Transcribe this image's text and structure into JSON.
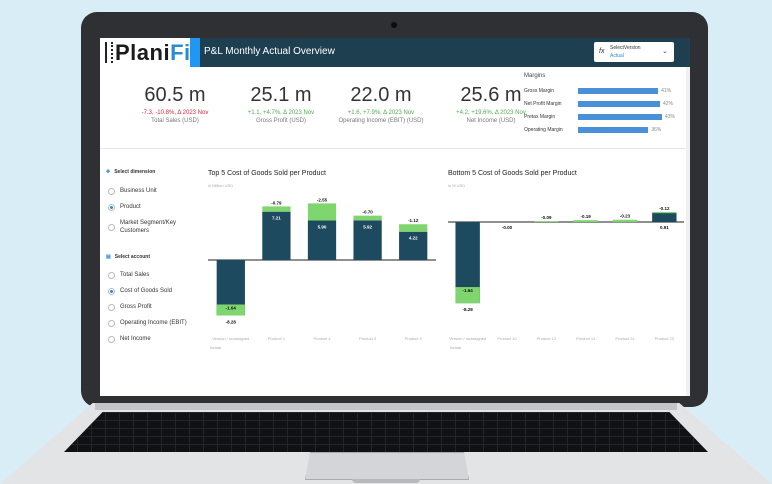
{
  "app": {
    "logo_text_main": "Plani",
    "logo_text_accent": "Fi",
    "title": "P&L Monthly Actual Overview",
    "select_version_label": "SelectVersion",
    "select_version_value": "Actual",
    "fx_symbol": "fx"
  },
  "kpis": [
    {
      "value": "60.5 m",
      "delta": "-7.3, -10.8%, Δ 2023 Nov",
      "name": "Total Sales (USD)",
      "delta_color": "#e0243a"
    },
    {
      "value": "25.1 m",
      "delta": "+1.1, +4.7%, Δ 2023 Nov",
      "name": "Gross Profit (USD)",
      "delta_color": "#4cae4c"
    },
    {
      "value": "22.0 m",
      "delta": "+1.6, +7.9%, Δ 2023 Nov",
      "name": "Operating Income (EBIT) (USD)",
      "delta_color": "#4cae4c"
    },
    {
      "value": "25.6 m",
      "delta": "+4.2, +19.6%, Δ 2023 Nov",
      "name": "Net Income (USD)",
      "delta_color": "#4cae4c"
    }
  ],
  "margins": {
    "title": "Margins",
    "rows": [
      {
        "label": "Gross Margin",
        "pct_label": "41%",
        "value": 0.41
      },
      {
        "label": "Net Profit Margin",
        "pct_label": "42%",
        "value": 0.42
      },
      {
        "label": "Pretax Margin",
        "pct_label": "43%",
        "value": 0.43
      },
      {
        "label": "Operating Margin",
        "pct_label": "36%",
        "value": 0.36
      }
    ]
  },
  "filters": {
    "dimension_title": "Select dimension",
    "dimension_options": [
      "Business Unit",
      "Product",
      "Market Segment/Key Customers"
    ],
    "dimension_selected": 1,
    "account_title": "Select account",
    "account_options": [
      "Total Sales",
      "Cost of Goods Sold",
      "Gross Profit",
      "Operating Income (EBIT)",
      "Net Income"
    ],
    "account_selected": 1
  },
  "chart_data": [
    {
      "type": "bar",
      "title": "Top 5 Cost of Goods Sold per Product",
      "unit_label": "in Million USD",
      "categories": [
        "Version / unassigned",
        "Product 1",
        "Product 4",
        "Product 3",
        "Product 5"
      ],
      "footer": "Actual",
      "base_values": [
        -8.28,
        7.21,
        5.9,
        5.92,
        4.22
      ],
      "delta_values": [
        -1.64,
        -0.79,
        -2.55,
        -0.7,
        -1.12
      ],
      "base_labels": [
        "-8.28",
        "7.21",
        "5.90",
        "5.92",
        "4.22"
      ],
      "delta_labels": [
        "-1.64",
        "-0.79",
        "-2.55",
        "-0.70",
        "-1.12"
      ]
    },
    {
      "type": "bar",
      "title": "Bottom 5 Cost of Goods Sold per Product",
      "unit_label": "in M USD",
      "categories": [
        "Version / unassigned",
        "Product 10",
        "Product 12",
        "Product 13",
        "Product 21",
        "Product 23"
      ],
      "footer": "Actual",
      "base_values": [
        -8.28,
        0.0,
        0.0,
        0.0,
        0.0,
        0.91
      ],
      "delta_values": [
        -1.64,
        0.0,
        -0.09,
        -0.19,
        -0.23,
        -0.12
      ],
      "base_labels": [
        "-8.28",
        "-0.00",
        "",
        "",
        "",
        "0.91"
      ],
      "delta_labels": [
        "-1.64",
        "",
        "-0.09",
        "-0.19",
        "-0.23",
        "-0.12"
      ]
    }
  ],
  "colors": {
    "header_bg": "#1e3f50",
    "accent": "#2196f3",
    "bar_base": "#1d4a5e",
    "bar_delta": "#80d66e",
    "negative": "#e0243a",
    "positive": "#4cae4c"
  }
}
